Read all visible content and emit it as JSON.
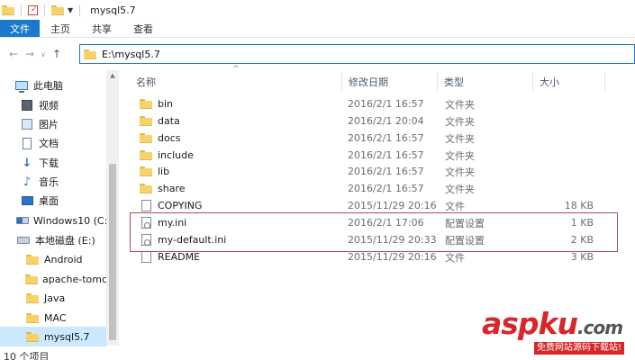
{
  "window": {
    "title": "mysql5.7"
  },
  "ribbon": {
    "tabs": [
      "文件",
      "主页",
      "共享",
      "查看"
    ]
  },
  "address": {
    "path": "E:\\mysql5.7"
  },
  "nav": {
    "items": [
      {
        "label": "此电脑",
        "icon": "computer-icon"
      },
      {
        "label": "视频",
        "icon": "video-icon"
      },
      {
        "label": "图片",
        "icon": "pictures-icon"
      },
      {
        "label": "文档",
        "icon": "documents-icon"
      },
      {
        "label": "下载",
        "icon": "download-icon"
      },
      {
        "label": "音乐",
        "icon": "music-icon"
      },
      {
        "label": "桌面",
        "icon": "desktop-icon"
      },
      {
        "label": "Windows10 (C:",
        "icon": "windows-drive-icon"
      },
      {
        "label": "本地磁盘 (E:)",
        "icon": "drive-icon"
      },
      {
        "label": "Android",
        "icon": "folder-icon"
      },
      {
        "label": "apache-tomca",
        "icon": "folder-icon"
      },
      {
        "label": "Java",
        "icon": "folder-icon"
      },
      {
        "label": "MAC",
        "icon": "folder-icon"
      },
      {
        "label": "mysql5.7",
        "icon": "folder-icon",
        "selected": true
      }
    ]
  },
  "columns": {
    "name": "名称",
    "date": "修改日期",
    "type": "类型",
    "size": "大小"
  },
  "files": [
    {
      "name": "bin",
      "date": "2016/2/1 16:57",
      "type": "文件夹",
      "size": "",
      "icon": "folder-icon"
    },
    {
      "name": "data",
      "date": "2016/2/1 20:04",
      "type": "文件夹",
      "size": "",
      "icon": "folder-icon"
    },
    {
      "name": "docs",
      "date": "2016/2/1 16:57",
      "type": "文件夹",
      "size": "",
      "icon": "folder-icon"
    },
    {
      "name": "include",
      "date": "2016/2/1 16:57",
      "type": "文件夹",
      "size": "",
      "icon": "folder-icon"
    },
    {
      "name": "lib",
      "date": "2016/2/1 16:57",
      "type": "文件夹",
      "size": "",
      "icon": "folder-icon"
    },
    {
      "name": "share",
      "date": "2016/2/1 16:57",
      "type": "文件夹",
      "size": "",
      "icon": "folder-icon"
    },
    {
      "name": "COPYING",
      "date": "2015/11/29 20:16",
      "type": "文件",
      "size": "18 KB",
      "icon": "file-icon"
    },
    {
      "name": "my.ini",
      "date": "2016/2/1 17:06",
      "type": "配置设置",
      "size": "1 KB",
      "icon": "config-file-icon"
    },
    {
      "name": "my-default.ini",
      "date": "2015/11/29 20:33",
      "type": "配置设置",
      "size": "2 KB",
      "icon": "config-file-icon"
    },
    {
      "name": "README",
      "date": "2015/11/29 20:16",
      "type": "文件",
      "size": "3 KB",
      "icon": "file-icon"
    }
  ],
  "status": {
    "text": "10 个项目"
  },
  "watermark": {
    "main_red": "asp",
    "main_k": "k",
    "main_u": "u",
    "dot": ".",
    "com": "com",
    "sub": "免费网站源码下载站!"
  }
}
